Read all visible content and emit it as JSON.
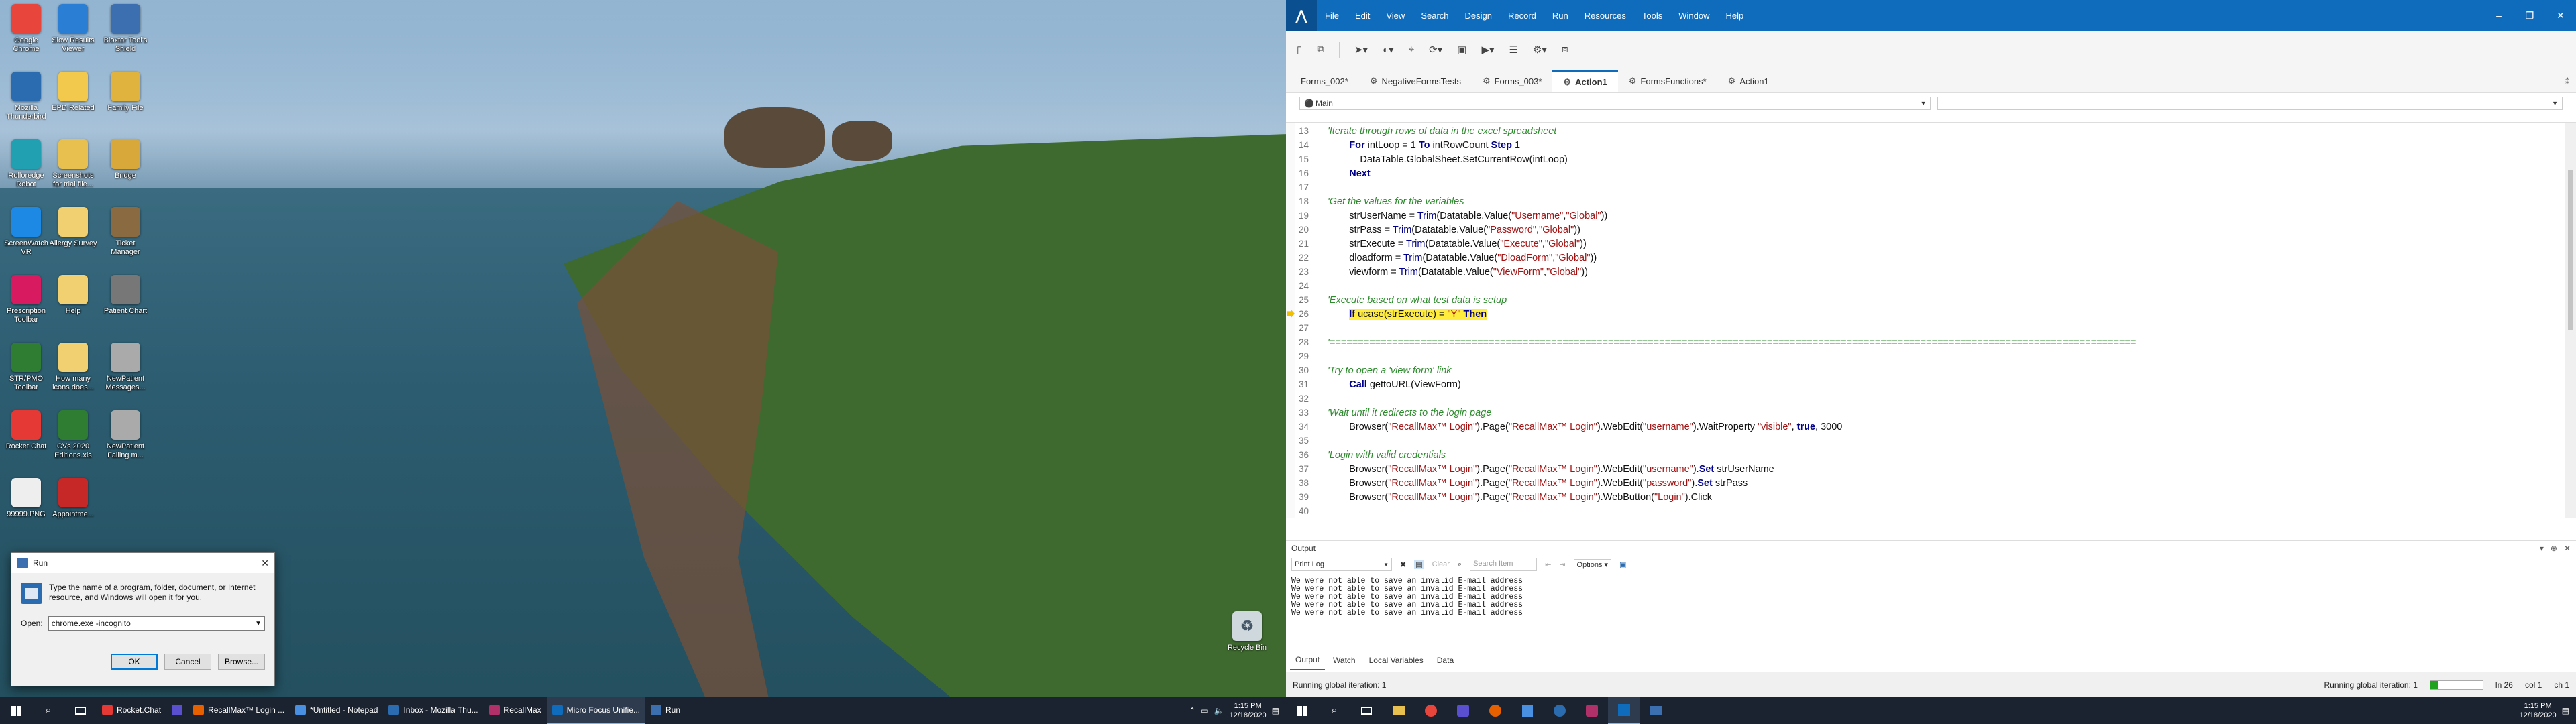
{
  "desktop": {
    "icons": [
      {
        "label": "Google Chrome",
        "color": "#e8453c"
      },
      {
        "label": "Slow Results Viewer",
        "color": "#2a7fd4"
      },
      {
        "label": "Bioxtor Tool's Shield",
        "color": "#3c6fb0"
      },
      {
        "label": "Mozilla Thunderbird",
        "color": "#2b6cb0"
      },
      {
        "label": "EPD Related",
        "color": "#f2c94c"
      },
      {
        "label": "Family File",
        "color": "#e0b23e"
      },
      {
        "label": "Rolloredge Robot",
        "color": "#20a0b0"
      },
      {
        "label": "Screenshots for trial file...",
        "color": "#e8c050"
      },
      {
        "label": "Bridge",
        "color": "#d9a83a"
      },
      {
        "label": "ScreenWatch VR",
        "color": "#1e88e5"
      },
      {
        "label": "Allergy Survey",
        "color": "#f0d070"
      },
      {
        "label": "Ticket Manager",
        "color": "#8a6a40"
      },
      {
        "label": "Prescription Toolbar",
        "color": "#d81b60"
      },
      {
        "label": "Help",
        "color": "#f0d070"
      },
      {
        "label": "Patient Chart",
        "color": "#777777"
      },
      {
        "label": "STR/PMO Toolbar",
        "color": "#2e7d32"
      },
      {
        "label": "How many icons does...",
        "color": "#f0d070"
      },
      {
        "label": "NewPatient Messages...",
        "color": "#aaaaaa"
      },
      {
        "label": "Rocket.Chat",
        "color": "#e53935"
      },
      {
        "label": "CVs 2020 Editions.xls",
        "color": "#2e7d32"
      },
      {
        "label": "NewPatient Failing m...",
        "color": "#aaaaaa"
      },
      {
        "label": "99999.PNG",
        "color": "#eeeeee"
      },
      {
        "label": "Appointme...",
        "color": "#c62828"
      }
    ],
    "recycle_bin": "Recycle Bin"
  },
  "run_dialog": {
    "title": "Run",
    "description": "Type the name of a program, folder, document, or Internet resource, and Windows will open it for you.",
    "open_label": "Open:",
    "open_value": "chrome.exe -incognito",
    "ok": "OK",
    "cancel": "Cancel",
    "browse": "Browse..."
  },
  "taskbar_left": {
    "apps": [
      {
        "label": "Rocket.Chat",
        "color": "#e53935",
        "active": false
      },
      {
        "label": "",
        "color": "#5a4fcf",
        "active": false
      },
      {
        "label": "RecallMax™ Login ...",
        "color": "#e66000",
        "active": false
      },
      {
        "label": "*Untitled - Notepad",
        "color": "#4a90e2",
        "active": false
      },
      {
        "label": "Inbox - Mozilla Thu...",
        "color": "#2b6cb0",
        "active": false
      },
      {
        "label": "RecallMax",
        "color": "#b0306a",
        "active": false
      },
      {
        "label": "Micro Focus Unifie...",
        "color": "#0f6cbd",
        "active": true
      },
      {
        "label": "Run",
        "color": "#3c6fb0",
        "active": false
      }
    ],
    "time": "1:15 PM",
    "date": "12/18/2020"
  },
  "taskbar_right": {
    "time": "1:15 PM",
    "date": "12/18/2020"
  },
  "uft": {
    "logo": "⋀",
    "menu": [
      "File",
      "Edit",
      "View",
      "Search",
      "Design",
      "Record",
      "Run",
      "Resources",
      "Tools",
      "Window",
      "Help"
    ],
    "tabs": [
      {
        "label": "Forms_002*",
        "active": false
      },
      {
        "label": "NegativeFormsTests",
        "active": false
      },
      {
        "label": "Forms_003*",
        "active": false
      },
      {
        "label": "Action1",
        "active": true
      },
      {
        "label": "FormsFunctions*",
        "active": false
      },
      {
        "label": "Action1",
        "active": false
      }
    ],
    "selector_value": "Main",
    "code": [
      {
        "n": "13",
        "parts": [
          {
            "c": "cm",
            "t": "'Iterate through rows of data in the excel spreadsheet"
          }
        ]
      },
      {
        "n": "14",
        "parts": [
          {
            "c": "",
            "t": "        "
          },
          {
            "c": "kw",
            "t": "For"
          },
          {
            "c": "",
            "t": " intLoop = 1 "
          },
          {
            "c": "kw",
            "t": "To"
          },
          {
            "c": "",
            "t": " intRowCount "
          },
          {
            "c": "kw",
            "t": "Step"
          },
          {
            "c": "",
            "t": " 1"
          }
        ]
      },
      {
        "n": "15",
        "parts": [
          {
            "c": "",
            "t": "            DataTable.GlobalSheet.SetCurrentRow(intLoop)"
          }
        ]
      },
      {
        "n": "16",
        "parts": [
          {
            "c": "",
            "t": "        "
          },
          {
            "c": "kw",
            "t": "Next"
          }
        ]
      },
      {
        "n": "17",
        "parts": [
          {
            "c": "",
            "t": ""
          }
        ]
      },
      {
        "n": "18",
        "parts": [
          {
            "c": "cm",
            "t": "'Get the values for the variables"
          }
        ]
      },
      {
        "n": "19",
        "parts": [
          {
            "c": "",
            "t": "        strUserName = "
          },
          {
            "c": "fn",
            "t": "Trim"
          },
          {
            "c": "",
            "t": "(Datatable.Value("
          },
          {
            "c": "str",
            "t": "\"Username\""
          },
          {
            "c": "",
            "t": ","
          },
          {
            "c": "str",
            "t": "\"Global\""
          },
          {
            "c": "",
            "t": "))"
          }
        ]
      },
      {
        "n": "20",
        "parts": [
          {
            "c": "",
            "t": "        strPass = "
          },
          {
            "c": "fn",
            "t": "Trim"
          },
          {
            "c": "",
            "t": "(Datatable.Value("
          },
          {
            "c": "str",
            "t": "\"Password\""
          },
          {
            "c": "",
            "t": ","
          },
          {
            "c": "str",
            "t": "\"Global\""
          },
          {
            "c": "",
            "t": "))"
          }
        ]
      },
      {
        "n": "21",
        "parts": [
          {
            "c": "",
            "t": "        strExecute = "
          },
          {
            "c": "fn",
            "t": "Trim"
          },
          {
            "c": "",
            "t": "(Datatable.Value("
          },
          {
            "c": "str",
            "t": "\"Execute\""
          },
          {
            "c": "",
            "t": ","
          },
          {
            "c": "str",
            "t": "\"Global\""
          },
          {
            "c": "",
            "t": "))"
          }
        ]
      },
      {
        "n": "22",
        "parts": [
          {
            "c": "",
            "t": "        dloadform = "
          },
          {
            "c": "fn",
            "t": "Trim"
          },
          {
            "c": "",
            "t": "(Datatable.Value("
          },
          {
            "c": "str",
            "t": "\"DloadForm\""
          },
          {
            "c": "",
            "t": ","
          },
          {
            "c": "str",
            "t": "\"Global\""
          },
          {
            "c": "",
            "t": "))"
          }
        ]
      },
      {
        "n": "23",
        "parts": [
          {
            "c": "",
            "t": "        viewform = "
          },
          {
            "c": "fn",
            "t": "Trim"
          },
          {
            "c": "",
            "t": "(Datatable.Value("
          },
          {
            "c": "str",
            "t": "\"ViewForm\""
          },
          {
            "c": "",
            "t": ","
          },
          {
            "c": "str",
            "t": "\"Global\""
          },
          {
            "c": "",
            "t": "))"
          }
        ]
      },
      {
        "n": "24",
        "parts": [
          {
            "c": "",
            "t": ""
          }
        ]
      },
      {
        "n": "25",
        "parts": [
          {
            "c": "cm",
            "t": "'Execute based on what test data is setup"
          }
        ]
      },
      {
        "n": "26",
        "current": true,
        "parts": [
          {
            "c": "",
            "t": "        "
          },
          {
            "c": "kw hl",
            "t": "If"
          },
          {
            "c": "hl",
            "t": " ucase(strExecute) = "
          },
          {
            "c": "str hl",
            "t": "\"Y\""
          },
          {
            "c": "kw hl",
            "t": " Then"
          }
        ]
      },
      {
        "n": "27",
        "parts": [
          {
            "c": "",
            "t": ""
          }
        ]
      },
      {
        "n": "28",
        "parts": [
          {
            "c": "cm",
            "t": "'=============================================================================================================================================="
          }
        ]
      },
      {
        "n": "29",
        "parts": [
          {
            "c": "",
            "t": ""
          }
        ]
      },
      {
        "n": "30",
        "parts": [
          {
            "c": "cm",
            "t": "'Try to open a 'view form' link"
          }
        ]
      },
      {
        "n": "31",
        "parts": [
          {
            "c": "",
            "t": "        "
          },
          {
            "c": "kw",
            "t": "Call"
          },
          {
            "c": "",
            "t": " gettoURL(ViewForm)"
          }
        ]
      },
      {
        "n": "32",
        "parts": [
          {
            "c": "",
            "t": ""
          }
        ]
      },
      {
        "n": "33",
        "parts": [
          {
            "c": "cm",
            "t": "'Wait until it redirects to the login page"
          }
        ]
      },
      {
        "n": "34",
        "parts": [
          {
            "c": "",
            "t": "        Browser("
          },
          {
            "c": "str",
            "t": "\"RecallMax™ Login\""
          },
          {
            "c": "",
            "t": ").Page("
          },
          {
            "c": "str",
            "t": "\"RecallMax™ Login\""
          },
          {
            "c": "",
            "t": ").WebEdit("
          },
          {
            "c": "str",
            "t": "\"username\""
          },
          {
            "c": "",
            "t": ").WaitProperty "
          },
          {
            "c": "str",
            "t": "\"visible\""
          },
          {
            "c": "",
            "t": ", "
          },
          {
            "c": "kw",
            "t": "true"
          },
          {
            "c": "",
            "t": ", 3000"
          }
        ]
      },
      {
        "n": "35",
        "parts": [
          {
            "c": "",
            "t": ""
          }
        ]
      },
      {
        "n": "36",
        "parts": [
          {
            "c": "cm",
            "t": "'Login with valid credentials"
          }
        ]
      },
      {
        "n": "37",
        "parts": [
          {
            "c": "",
            "t": "        Browser("
          },
          {
            "c": "str",
            "t": "\"RecallMax™ Login\""
          },
          {
            "c": "",
            "t": ").Page("
          },
          {
            "c": "str",
            "t": "\"RecallMax™ Login\""
          },
          {
            "c": "",
            "t": ").WebEdit("
          },
          {
            "c": "str",
            "t": "\"username\""
          },
          {
            "c": "",
            "t": ")."
          },
          {
            "c": "kw",
            "t": "Set"
          },
          {
            "c": "",
            "t": " strUserName"
          }
        ]
      },
      {
        "n": "38",
        "parts": [
          {
            "c": "",
            "t": "        Browser("
          },
          {
            "c": "str",
            "t": "\"RecallMax™ Login\""
          },
          {
            "c": "",
            "t": ").Page("
          },
          {
            "c": "str",
            "t": "\"RecallMax™ Login\""
          },
          {
            "c": "",
            "t": ").WebEdit("
          },
          {
            "c": "str",
            "t": "\"password\""
          },
          {
            "c": "",
            "t": ")."
          },
          {
            "c": "kw",
            "t": "Set"
          },
          {
            "c": "",
            "t": " strPass"
          }
        ]
      },
      {
        "n": "39",
        "parts": [
          {
            "c": "",
            "t": "        Browser("
          },
          {
            "c": "str",
            "t": "\"RecallMax™ Login\""
          },
          {
            "c": "",
            "t": ").Page("
          },
          {
            "c": "str",
            "t": "\"RecallMax™ Login\""
          },
          {
            "c": "",
            "t": ").WebButton("
          },
          {
            "c": "str",
            "t": "\"Login\""
          },
          {
            "c": "",
            "t": ").Click"
          }
        ]
      },
      {
        "n": "40",
        "parts": [
          {
            "c": "",
            "t": ""
          }
        ]
      }
    ],
    "output": {
      "title": "Output",
      "dropdown": "Print Log",
      "search_placeholder": "Search Item",
      "options": "Options",
      "clear_label": "Clear",
      "lines": [
        "We were not able to save an invalid E-mail address",
        "We were not able to save an invalid E-mail address",
        "We were not able to save an invalid E-mail address",
        "We were not able to save an invalid E-mail address",
        "We were not able to save an invalid E-mail address"
      ],
      "tabs": [
        "Output",
        "Watch",
        "Local Variables",
        "Data"
      ]
    },
    "status": {
      "left": "Running global iteration: 1",
      "right": "Running global iteration: 1",
      "progress": 0.15,
      "line": "ln 26",
      "col": "col 1",
      "ch": "ch 1"
    }
  }
}
